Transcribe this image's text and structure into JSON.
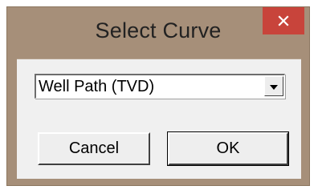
{
  "dialog": {
    "title": "Select Curve",
    "close_icon": "close-icon"
  },
  "curve_select": {
    "selected_value": "Well Path (TVD)",
    "arrow_icon": "chevron-down-icon"
  },
  "buttons": {
    "cancel_label": "Cancel",
    "ok_label": "OK"
  },
  "colors": {
    "frame": "#a68f79",
    "close_button": "#c8443b",
    "client_area": "#f0f0f0"
  }
}
